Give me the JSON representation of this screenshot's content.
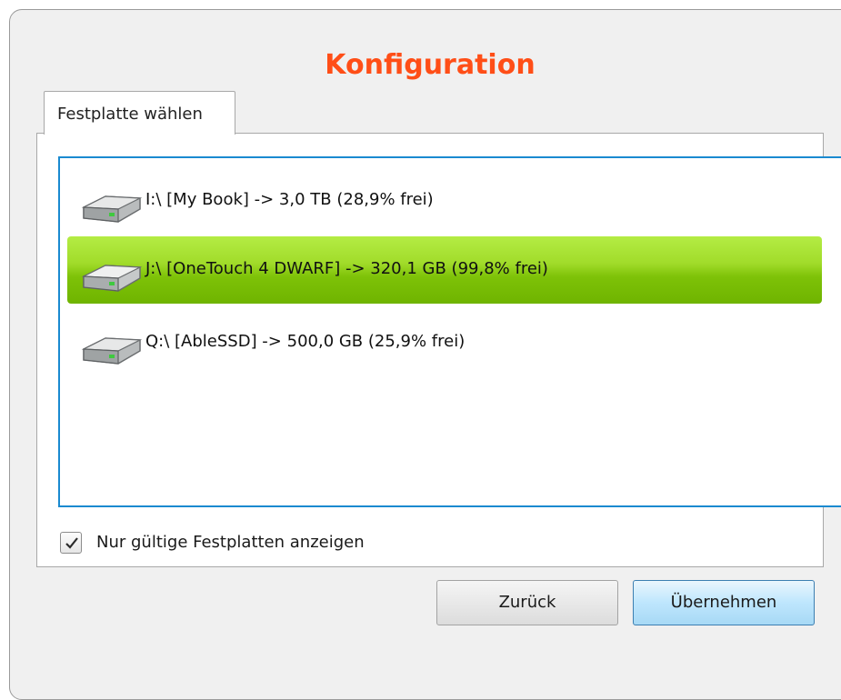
{
  "dialog": {
    "title": "Konfiguration",
    "title_color": "#ff4e17"
  },
  "tab": {
    "label": "Festplatte wählen"
  },
  "drives": [
    {
      "label": "I:\\ [My Book] -> 3,0 TB (28,9% frei)",
      "icon": "hard-drive-icon",
      "selected": false
    },
    {
      "label": "J:\\ [OneTouch 4 DWARF] -> 320,1 GB (99,8% frei)",
      "icon": "hard-drive-icon",
      "selected": true
    },
    {
      "label": "Q:\\ [AbleSSD] -> 500,0 GB (25,9% frei)",
      "icon": "hard-drive-icon",
      "selected": false
    }
  ],
  "filter": {
    "label": "Nur gültige Festplatten anzeigen",
    "checked": true
  },
  "buttons": {
    "back_label": "Zurück",
    "apply_label": "Übernehmen"
  },
  "colors": {
    "selection": "#7ec208",
    "list_border": "#1a8ad0"
  }
}
